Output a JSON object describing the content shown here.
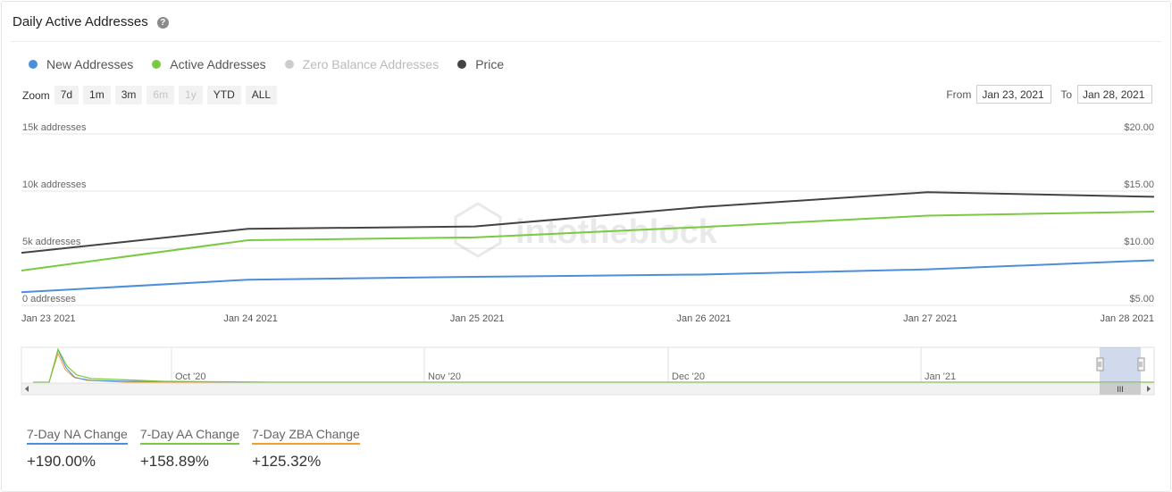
{
  "header": {
    "title": "Daily Active Addresses",
    "help_icon": "question-circle-icon"
  },
  "legend": [
    {
      "label": "New Addresses",
      "color": "#4a8fdc",
      "enabled": true
    },
    {
      "label": "Active Addresses",
      "color": "#7ac943",
      "enabled": true
    },
    {
      "label": "Zero Balance Addresses",
      "color": "#cccccc",
      "enabled": false
    },
    {
      "label": "Price",
      "color": "#444444",
      "enabled": true
    }
  ],
  "zoom": {
    "label": "Zoom",
    "buttons": [
      {
        "label": "7d",
        "enabled": true
      },
      {
        "label": "1m",
        "enabled": true
      },
      {
        "label": "3m",
        "enabled": true
      },
      {
        "label": "6m",
        "enabled": false
      },
      {
        "label": "1y",
        "enabled": false
      },
      {
        "label": "YTD",
        "enabled": true
      },
      {
        "label": "ALL",
        "enabled": true
      }
    ]
  },
  "range": {
    "from_label": "From",
    "from_value": "Jan 23, 2021",
    "to_label": "To",
    "to_value": "Jan 28, 2021"
  },
  "watermark": "intotheblock",
  "chart_data": {
    "type": "line",
    "x": [
      "Jan 23 2021",
      "Jan 24 2021",
      "Jan 25 2021",
      "Jan 26 2021",
      "Jan 27 2021",
      "Jan 28 2021"
    ],
    "y_left": {
      "ticks": [
        "0 addresses",
        "5k addresses",
        "10k addresses",
        "15k addresses"
      ],
      "range": [
        0,
        15000
      ]
    },
    "y_right": {
      "ticks": [
        "$5.00",
        "$10.00",
        "$15.00",
        "$20.00"
      ],
      "range": [
        5,
        20
      ]
    },
    "series": [
      {
        "name": "New Addresses",
        "axis": "left",
        "color": "#4a8fdc",
        "values": [
          1150,
          2250,
          2500,
          2700,
          3150,
          3950
        ]
      },
      {
        "name": "Active Addresses",
        "axis": "left",
        "color": "#7ac943",
        "values": [
          3050,
          5700,
          5950,
          6850,
          7850,
          8200
        ]
      },
      {
        "name": "Price",
        "axis": "right",
        "color": "#444444",
        "values": [
          9.6,
          11.7,
          11.9,
          13.6,
          14.9,
          14.5
        ]
      }
    ],
    "grid": true
  },
  "navigator": {
    "labels": [
      "Oct '20",
      "Nov '20",
      "Dec '20",
      "Jan '21"
    ],
    "handle_glyph": "III"
  },
  "stats": [
    {
      "label": "7-Day NA Change",
      "value": "+190.00%",
      "color": "#4a8fdc"
    },
    {
      "label": "7-Day AA Change",
      "value": "+158.89%",
      "color": "#7ac943"
    },
    {
      "label": "7-Day ZBA Change",
      "value": "+125.32%",
      "color": "#f0a030"
    }
  ]
}
